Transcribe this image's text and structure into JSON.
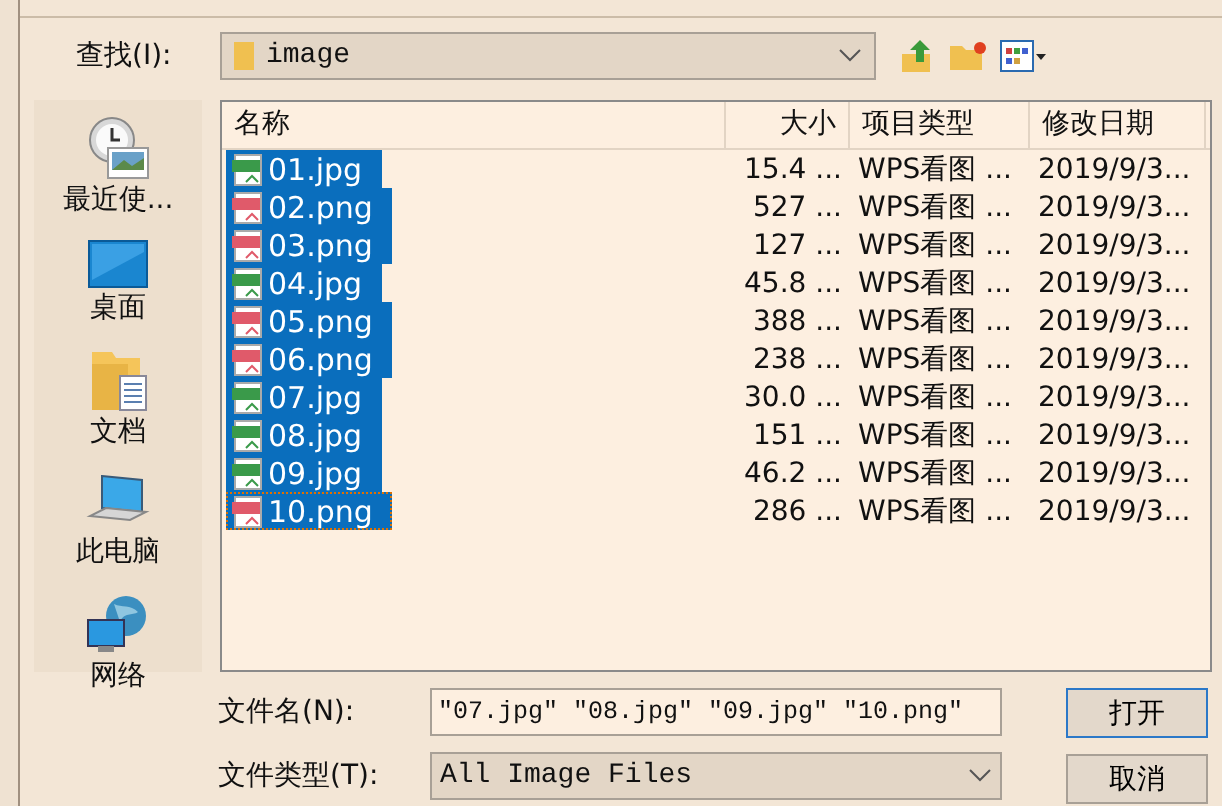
{
  "look_in": {
    "label": "查找(I):",
    "value": "image"
  },
  "places": [
    {
      "label": "最近使...",
      "kind": "recent"
    },
    {
      "label": "桌面",
      "kind": "desktop"
    },
    {
      "label": "文档",
      "kind": "documents"
    },
    {
      "label": "此电脑",
      "kind": "computer"
    },
    {
      "label": "网络",
      "kind": "network"
    }
  ],
  "columns": [
    "名称",
    "大小",
    "项目类型",
    "修改日期"
  ],
  "files": [
    {
      "name": "01.jpg",
      "kind": "jpg",
      "size": "15.4 ...",
      "type": "WPS看图 ...",
      "date": "2019/9/3...",
      "selected": true,
      "focused": false
    },
    {
      "name": "02.png",
      "kind": "png",
      "size": "527 ...",
      "type": "WPS看图 ...",
      "date": "2019/9/3...",
      "selected": true,
      "focused": false
    },
    {
      "name": "03.png",
      "kind": "png",
      "size": "127 ...",
      "type": "WPS看图 ...",
      "date": "2019/9/3...",
      "selected": true,
      "focused": false
    },
    {
      "name": "04.jpg",
      "kind": "jpg",
      "size": "45.8 ...",
      "type": "WPS看图 ...",
      "date": "2019/9/3...",
      "selected": true,
      "focused": false
    },
    {
      "name": "05.png",
      "kind": "png",
      "size": "388 ...",
      "type": "WPS看图 ...",
      "date": "2019/9/3...",
      "selected": true,
      "focused": false
    },
    {
      "name": "06.png",
      "kind": "png",
      "size": "238 ...",
      "type": "WPS看图 ...",
      "date": "2019/9/3...",
      "selected": true,
      "focused": false
    },
    {
      "name": "07.jpg",
      "kind": "jpg",
      "size": "30.0 ...",
      "type": "WPS看图 ...",
      "date": "2019/9/3...",
      "selected": true,
      "focused": false
    },
    {
      "name": "08.jpg",
      "kind": "jpg",
      "size": "151 ...",
      "type": "WPS看图 ...",
      "date": "2019/9/3...",
      "selected": true,
      "focused": false
    },
    {
      "name": "09.jpg",
      "kind": "jpg",
      "size": "46.2 ...",
      "type": "WPS看图 ...",
      "date": "2019/9/3...",
      "selected": true,
      "focused": false
    },
    {
      "name": "10.png",
      "kind": "png",
      "size": "286 ...",
      "type": "WPS看图 ...",
      "date": "2019/9/3...",
      "selected": true,
      "focused": true
    }
  ],
  "file_name": {
    "label": "文件名(N):",
    "value": "\"07.jpg\" \"08.jpg\" \"09.jpg\" \"10.png\""
  },
  "file_type": {
    "label": "文件类型(T):",
    "value": "All Image Files"
  },
  "buttons": [
    "打开",
    "取消"
  ]
}
